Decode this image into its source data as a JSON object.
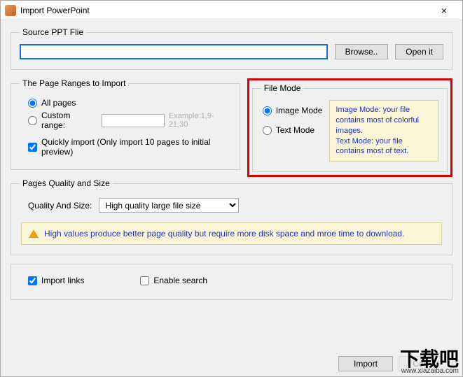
{
  "titlebar": {
    "title": "Import PowerPoint",
    "close": "×"
  },
  "source": {
    "legend": "Source PPT Flie",
    "value": "",
    "browse": "Browse..",
    "openit": "Open it"
  },
  "pageranges": {
    "legend": "The Page Ranges to Import",
    "allpages": "All pages",
    "custom": "Custom range:",
    "custom_value": "",
    "example": "Example:1,9-21,30",
    "quickly": "Quickly import (Only import 10 pages to  initial  preview)"
  },
  "filemode": {
    "legend": "File Mode",
    "image": "Image Mode",
    "text": "Text Mode",
    "desc": "Image Mode: your file contains most of colorful images.\nText Mode: your file contains most of text."
  },
  "quality": {
    "legend": "Pages Quality and Size",
    "label": "Quality And Size:",
    "selected": "High quality large file size",
    "options": [
      "High quality large file size"
    ],
    "warn": "High values produce better page quality but require more disk space and mroe time to download."
  },
  "checks": {
    "importlinks": "Import links",
    "enablesearch": "Enable search"
  },
  "footer": {
    "import": "Import",
    "cancel": "Cancel"
  },
  "watermark": {
    "main": "下载吧",
    "sub": "www.xiazaiba.com"
  }
}
